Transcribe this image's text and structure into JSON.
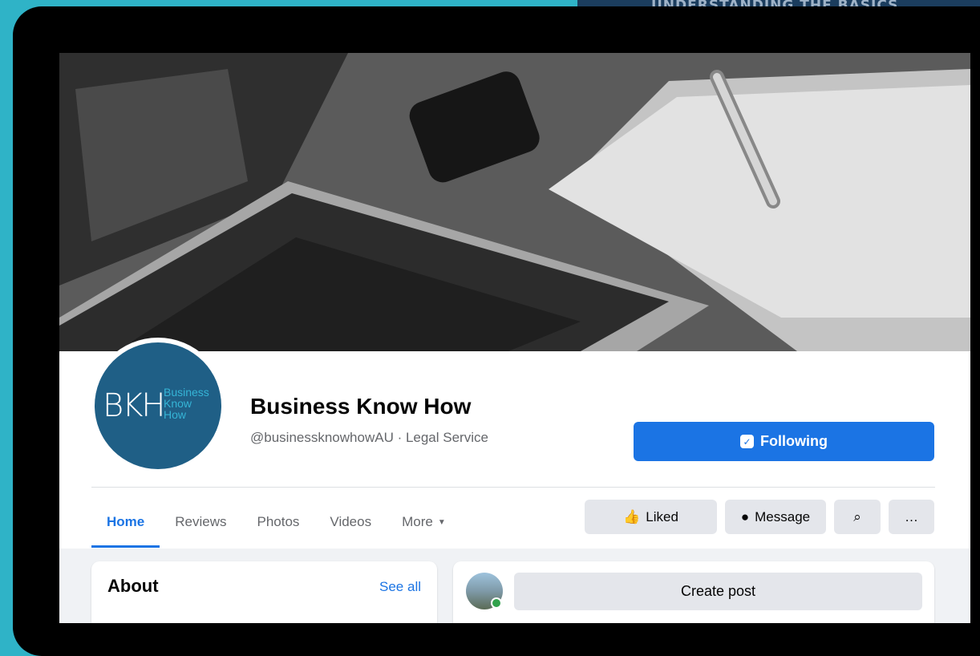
{
  "background_banner": {
    "text": "UNDERSTANDING THE BASICS"
  },
  "page": {
    "title": "Business Know How",
    "subtitle": "@businessknowhowAU · Legal Service",
    "logo": {
      "mark": "BKH",
      "text": "Business\nKnow\nHow"
    }
  },
  "buttons": {
    "following": "Following",
    "liked": "Liked",
    "message": "Message",
    "search_icon": "search-icon",
    "more_icon": "ellipsis-icon"
  },
  "nav": {
    "items": [
      {
        "label": "Home",
        "active": true
      },
      {
        "label": "Reviews",
        "active": false
      },
      {
        "label": "Photos",
        "active": false
      },
      {
        "label": "Videos",
        "active": false
      },
      {
        "label": "More",
        "active": false
      }
    ]
  },
  "about": {
    "title": "About",
    "link": "See all"
  },
  "composer": {
    "button": "Create post"
  },
  "colors": {
    "accent": "#1b74e4",
    "background": "#2fb3c7",
    "logo": "#1f5f86",
    "online": "#31a24c"
  }
}
